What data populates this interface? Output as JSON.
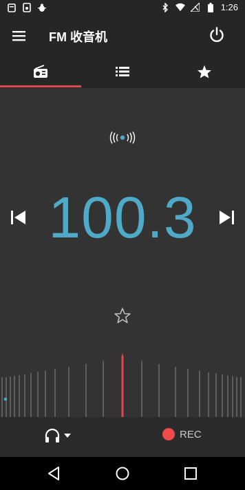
{
  "status_bar": {
    "time": "1:26",
    "left_icons": [
      "notification-icon",
      "phone-notification-icon",
      "debug-icon"
    ],
    "right_icons": [
      "bluetooth-icon",
      "wifi-icon",
      "no-signal-icon",
      "battery-icon"
    ]
  },
  "app_bar": {
    "title": "FM 收音机",
    "menu_icon": "menu-icon",
    "power_icon": "power-icon"
  },
  "tabs": [
    {
      "icon": "radio-icon",
      "selected": true
    },
    {
      "icon": "list-icon",
      "selected": false
    },
    {
      "icon": "star-icon",
      "selected": false
    }
  ],
  "player": {
    "frequency": "100.3",
    "signal_icon": "broadcast-icon",
    "favorite": false
  },
  "bottom_bar": {
    "audio_output_icon": "headphones-icon",
    "record_label": "REC"
  },
  "colors": {
    "accent": "#e0494f",
    "frequency": "#4eaac6",
    "background": "#333333",
    "bars": "#262626",
    "record": "#f04a4a"
  },
  "nav_bar": {
    "buttons": [
      "back-icon",
      "home-icon",
      "recents-icon"
    ]
  }
}
